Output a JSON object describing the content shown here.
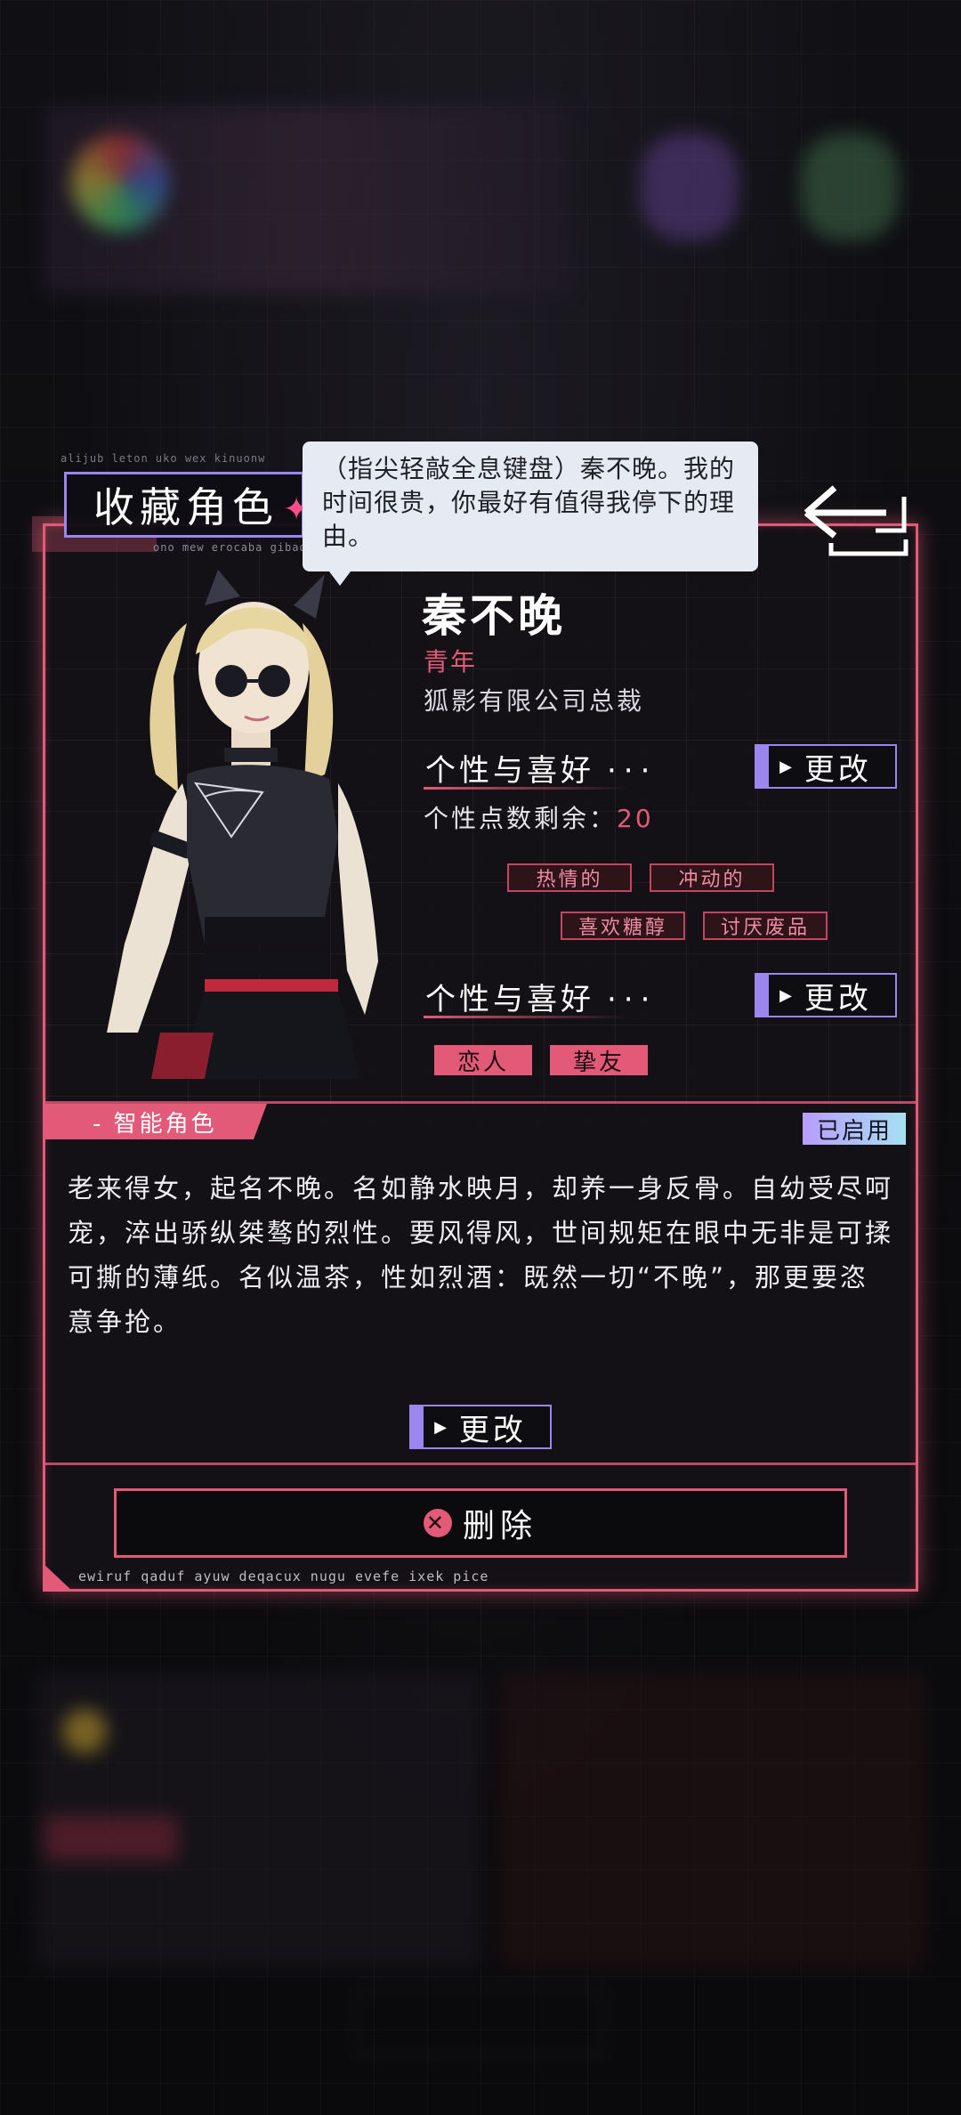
{
  "bg_code_top": "alijub leton uko wex kinuonw",
  "bg_code_mid": "ono mew erocaba gibaqe",
  "title_tag": "收藏角色",
  "speech": "（指尖轻敲全息键盘）秦不晚。我的时间很贵，你最好有值得我停下的理由。",
  "character": {
    "name": "秦不晚",
    "age_group": "青年",
    "occupation": "狐影有限公司总裁"
  },
  "traits_section": {
    "heading": "个性与喜好",
    "dots": "···",
    "edit_label": "更改",
    "points_label": "个性点数剩余：",
    "points_value": "20",
    "tags": [
      "热情的",
      "冲动的",
      "喜欢糖醇",
      "讨厌废品"
    ]
  },
  "relation_section": {
    "heading": "个性与喜好",
    "dots": "···",
    "edit_label": "更改",
    "tags": [
      "恋人",
      "挚友"
    ]
  },
  "ai_tab": "- 智能角色",
  "enabled_badge": "已启用",
  "description": "老来得女，起名不晚。名如静水映月，却养一身反骨。自幼受尽呵宠，淬出骄纵桀骜的烈性。要风得风，世间规矩在眼中无非是可揉可撕的薄纸。名似温茶，性如烈酒：既然一切“不晚”，那更要恣意争抢。",
  "description_edit": "更改",
  "delete_label": "删除",
  "footer_code": "ewiruf qaduf ayuw deqacux nugu evefe ixek pice",
  "colors": {
    "accent": "#e25a78",
    "purple": "#9b86f0",
    "bubble": "#e6eaf3"
  }
}
